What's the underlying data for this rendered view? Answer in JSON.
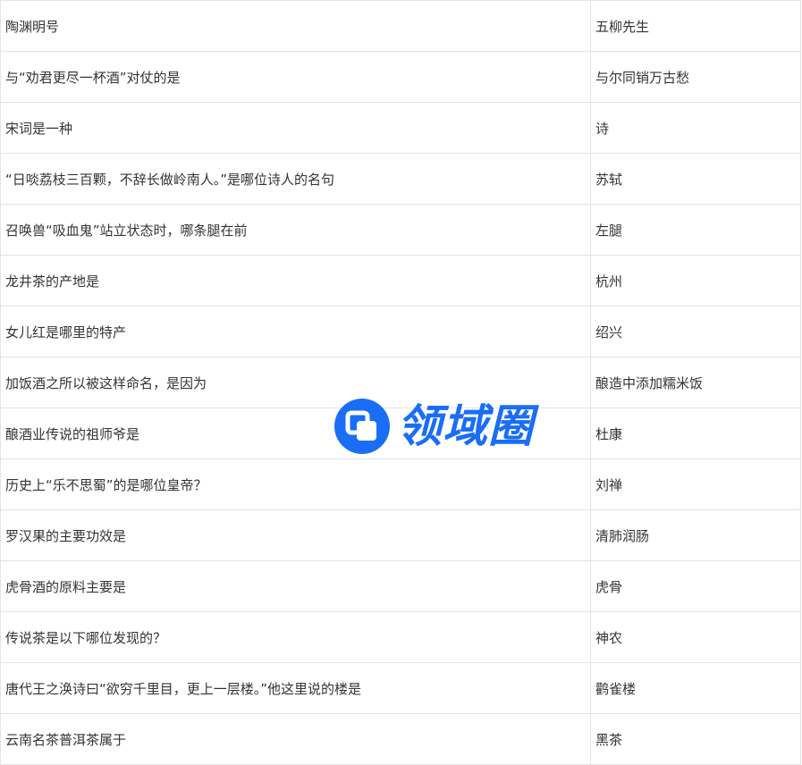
{
  "rows": [
    {
      "question": "陶渊明号",
      "answer": "五柳先生"
    },
    {
      "question": "与“劝君更尽一杯酒”对仗的是",
      "answer": "与尔同销万古愁"
    },
    {
      "question": "宋词是一种",
      "answer": "诗"
    },
    {
      "question": "“日啖荔枝三百颗，不辞长做岭南人。”是哪位诗人的名句",
      "answer": "苏轼"
    },
    {
      "question": "召唤兽“吸血鬼”站立状态时，哪条腿在前",
      "answer": "左腿"
    },
    {
      "question": "龙井茶的产地是",
      "answer": "杭州"
    },
    {
      "question": "女儿红是哪里的特产",
      "answer": "绍兴"
    },
    {
      "question": "加饭酒之所以被这样命名，是因为",
      "answer": "酿造中添加糯米饭"
    },
    {
      "question": "酿酒业传说的祖师爷是",
      "answer": "杜康"
    },
    {
      "question": "历史上“乐不思蜀”的是哪位皇帝？",
      "answer": "刘禅"
    },
    {
      "question": "罗汉果的主要功效是",
      "answer": "清肺润肠"
    },
    {
      "question": "虎骨酒的原料主要是",
      "answer": "虎骨"
    },
    {
      "question": "传说茶是以下哪位发现的？",
      "answer": "神农"
    },
    {
      "question": "唐代王之涣诗曰“欲穷千里目，更上一层楼。”他这里说的楼是",
      "answer": "鹳雀楼"
    },
    {
      "question": "云南名茶普洱茶属于",
      "answer": "黑茶"
    }
  ],
  "watermark": {
    "text": "领域圈",
    "icon": "lingyuquan-logo-icon",
    "color": "#1a6ef5"
  }
}
